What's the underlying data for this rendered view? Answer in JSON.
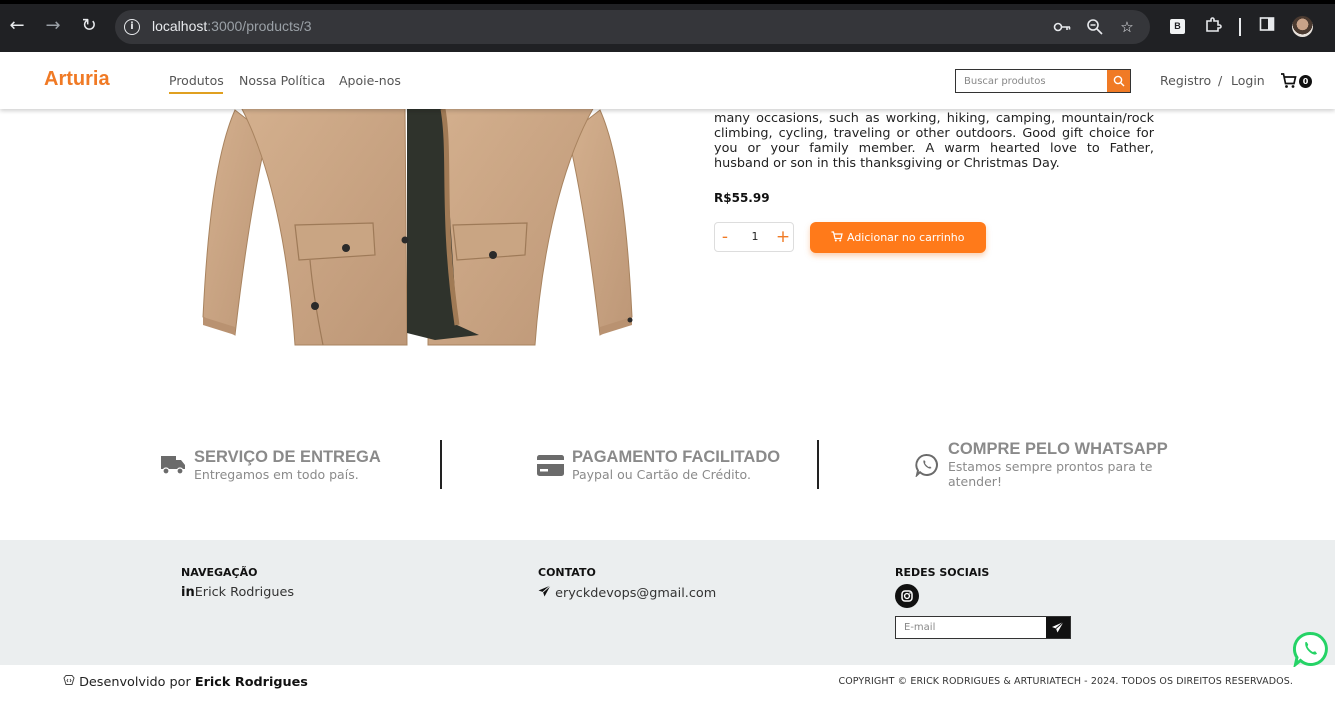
{
  "browser": {
    "url_host": "localhost",
    "url_rest": ":3000/products/3",
    "extension_badge": "B"
  },
  "header": {
    "logo": "Arturia",
    "nav": [
      {
        "label": "Produtos"
      },
      {
        "label": "Nossa Política"
      },
      {
        "label": "Apoie-nos"
      }
    ],
    "search_placeholder": "Buscar produtos",
    "register_label": "Registro",
    "auth_separator": "/",
    "login_label": "Login",
    "cart_count": "0"
  },
  "product": {
    "description": "many occasions, such as working, hiking, camping, mountain/rock climbing, cycling, traveling or other outdoors. Good gift choice for you or your family member. A warm hearted love to Father, husband or son in this thanksgiving or Christmas Day.",
    "price": "R$55.99",
    "quantity": "1",
    "decrement_label": "-",
    "increment_label": "+",
    "add_to_cart_label": "Adicionar no carrinho"
  },
  "features": [
    {
      "title": "SERVIÇO DE ENTREGA",
      "subtitle": "Entregamos em todo país.",
      "icon": "truck-icon"
    },
    {
      "title": "PAGAMENTO FACILITADO",
      "subtitle": "Paypal ou Cartão de Crédito.",
      "icon": "credit-card-icon"
    },
    {
      "title": "COMPRE PELO WHATSAPP",
      "subtitle": "Estamos sempre prontos para te atender!",
      "icon": "whatsapp-icon"
    }
  ],
  "footer": {
    "navigation_heading": "NAVEGAÇÃO",
    "navigation_link": "Erick Rodrigues",
    "navigation_icon_text": "in",
    "contact_heading": "CONTATO",
    "contact_email": "eryckdevops@gmail.com",
    "social_heading": "REDES SOCIAIS",
    "email_placeholder": "E-mail"
  },
  "bottom": {
    "developed_by": "Desenvolvido por",
    "developer": "Erick Rodrigues",
    "copyright": "COPYRIGHT © ERICK RODRIGUES & ARTURIATECH - 2024. TODOS OS DIREITOS RESERVADOS."
  },
  "colors": {
    "brand": "#f07a25",
    "button": "#ff7a1a",
    "footer_bg": "#ebeeef"
  }
}
